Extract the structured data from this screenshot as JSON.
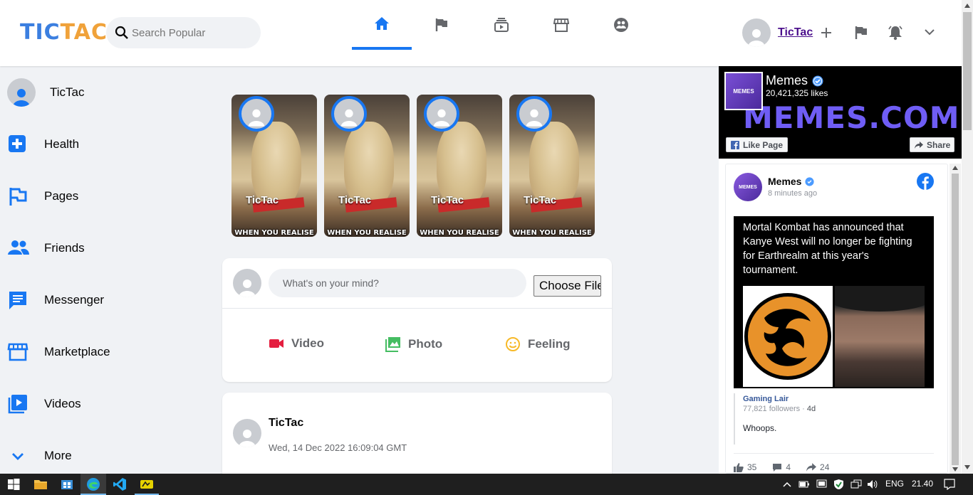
{
  "header": {
    "logo_part1": "TIC",
    "logo_part2": "TAC",
    "search_placeholder": "Search Popular",
    "username": "TicTac"
  },
  "sidebar": {
    "profile_name": "TicTac",
    "items": [
      {
        "label": "Health",
        "icon": "health-icon"
      },
      {
        "label": "Pages",
        "icon": "pages-icon"
      },
      {
        "label": "Friends",
        "icon": "friends-icon"
      },
      {
        "label": "Messenger",
        "icon": "messenger-icon"
      },
      {
        "label": "Marketplace",
        "icon": "marketplace-icon"
      },
      {
        "label": "Videos",
        "icon": "videos-icon"
      },
      {
        "label": "More",
        "icon": "chevron-down-icon"
      }
    ]
  },
  "stories": [
    {
      "name": "TicTac",
      "caption": "WHEN YOU REALISE"
    },
    {
      "name": "TicTac",
      "caption": "WHEN YOU REALISE"
    },
    {
      "name": "TicTac",
      "caption": "WHEN YOU REALISE"
    },
    {
      "name": "TicTac",
      "caption": "WHEN YOU REALISE"
    }
  ],
  "composer": {
    "placeholder": "What's on your mind?",
    "file_button": "Choose File",
    "actions": [
      {
        "label": "Video",
        "color": "#e41e3f"
      },
      {
        "label": "Photo",
        "color": "#45bd62"
      },
      {
        "label": "Feeling",
        "color": "#f7b928"
      }
    ]
  },
  "post": {
    "author": "TicTac",
    "date": "Wed, 14 Dec 2022 16:09:04 GMT"
  },
  "page_widget": {
    "name": "Memes",
    "likes": "20,421,325 likes",
    "banner_text": "MEMES.COM",
    "logo_text": "MEMES",
    "like_button": "Like Page",
    "share_button": "Share",
    "post": {
      "author": "Memes",
      "time": "8 minutes ago",
      "text": "Mortal Kombat has announced that Kanye West will no longer be fighting for Earthrealm at this year's tournament.",
      "source_name": "Gaming Lair",
      "source_followers": "77,821 followers",
      "source_age": "4d",
      "source_text": "Whoops.",
      "reactions": "35",
      "comments": "4",
      "shares": "24"
    }
  },
  "taskbar": {
    "language": "ENG",
    "time": "21.40"
  },
  "colors": {
    "accent": "#1877f2",
    "page_bg": "#f0f2f5"
  }
}
